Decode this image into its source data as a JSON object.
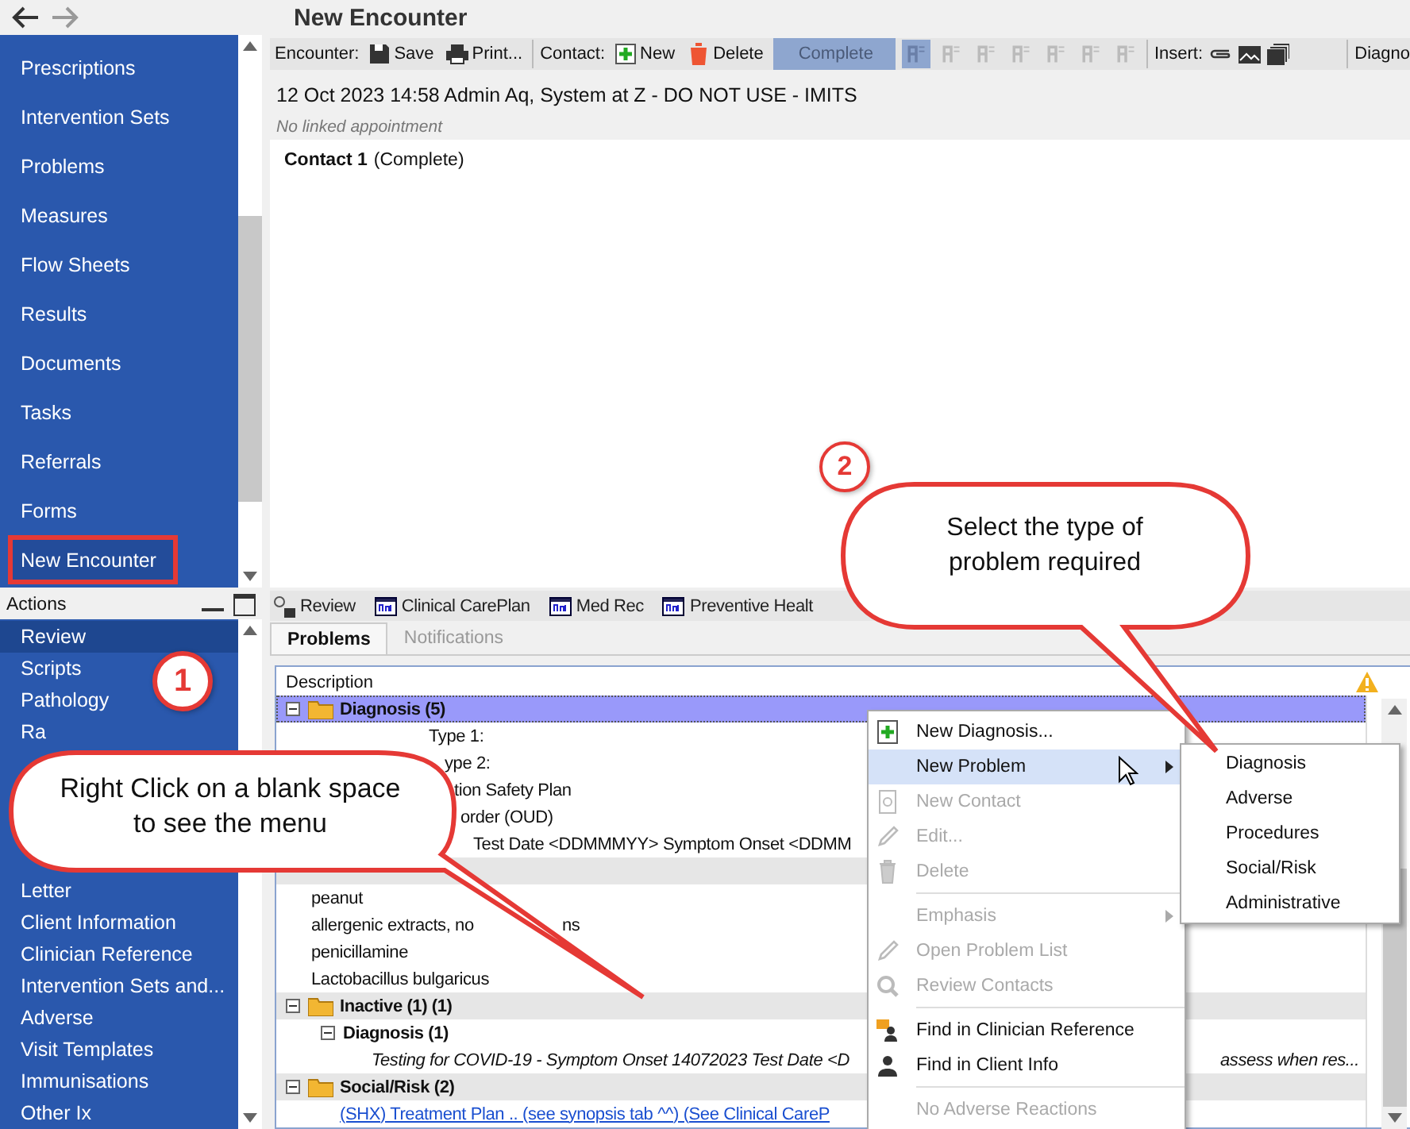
{
  "header": {
    "title": "New Encounter"
  },
  "nav": [
    {
      "label": "Prescriptions",
      "selected": false
    },
    {
      "label": "Intervention Sets",
      "selected": false
    },
    {
      "label": "Problems",
      "selected": false
    },
    {
      "label": "Measures",
      "selected": false
    },
    {
      "label": "Flow Sheets",
      "selected": false
    },
    {
      "label": "Results",
      "selected": false
    },
    {
      "label": "Documents",
      "selected": false
    },
    {
      "label": "Tasks",
      "selected": false
    },
    {
      "label": "Referrals",
      "selected": false
    },
    {
      "label": "Forms",
      "selected": false
    },
    {
      "label": "New Encounter",
      "selected": true
    }
  ],
  "toolbar": {
    "encounter_label": "Encounter:",
    "save": "Save",
    "print": "Print...",
    "contact_label": "Contact:",
    "new": "New",
    "delete": "Delete",
    "complete": "Complete",
    "insert_label": "Insert:",
    "cut_label": "Diagno"
  },
  "encounter": {
    "summary": "12 Oct 2023 14:58 Admin Aq, System at Z - DO NOT USE - IMITS",
    "appointment": "No linked appointment",
    "contact": "Contact 1",
    "contact_status": "(Complete)"
  },
  "actions": {
    "title": "Actions",
    "items_top": [
      {
        "label": "Review",
        "selected": true
      },
      {
        "label": "Scripts",
        "selected": false
      },
      {
        "label": "Pathology",
        "selected": false
      },
      {
        "label": "Ra",
        "selected": false
      }
    ],
    "items_bottom": [
      {
        "label": "Letter",
        "selected": false
      },
      {
        "label": "Client Information",
        "selected": false
      },
      {
        "label": "Clinician Reference",
        "selected": false
      },
      {
        "label": "Intervention Sets and...",
        "selected": false
      },
      {
        "label": "Adverse",
        "selected": false
      },
      {
        "label": "Visit Templates",
        "selected": false
      },
      {
        "label": "Immunisations",
        "selected": false
      },
      {
        "label": "Other Ix",
        "selected": false
      }
    ]
  },
  "tabs": [
    {
      "label": "Review",
      "selected": false
    },
    {
      "label": "Clinical CarePlan",
      "selected": false
    },
    {
      "label": "Med Rec",
      "selected": false
    },
    {
      "label": "Preventive Healt",
      "selected": false
    }
  ],
  "subtabs": [
    {
      "label": "Problems",
      "selected": true
    },
    {
      "label": "Notifications",
      "selected": false
    }
  ],
  "grid": {
    "column": "Description",
    "tree": [
      {
        "kind": "group",
        "label": "Diagnosis (5)",
        "selected": true,
        "children": [
          {
            "kind": "leaf",
            "label": "Type 1:"
          },
          {
            "kind": "leaf",
            "label": "ype 2:"
          },
          {
            "kind": "leaf",
            "label": "tion Safety Plan"
          },
          {
            "kind": "leaf",
            "label": "order (OUD)"
          },
          {
            "kind": "leaf",
            "label": "Test Date <DDMMMYY> Symptom Onset <DDMM"
          }
        ]
      },
      {
        "kind": "group",
        "selected": false,
        "children": [
          {
            "kind": "leaf",
            "label": "peanut"
          },
          {
            "kind": "leaf",
            "label": "allergenic extracts, no",
            "tail": "ns"
          },
          {
            "kind": "leaf",
            "label": "penicillamine"
          },
          {
            "kind": "leaf",
            "label": "Lactobacillus bulgaricus"
          }
        ]
      },
      {
        "kind": "group",
        "label": "Inactive (1) (1)",
        "selected": false,
        "children": [
          {
            "kind": "subgroup",
            "label": "Diagnosis (1)",
            "children": [
              {
                "kind": "note",
                "label": "Testing for COVID-19 - Symptom Onset 14072023 Test Date <D",
                "tail": "assess when res..."
              }
            ]
          }
        ]
      },
      {
        "kind": "group",
        "label": "Social/Risk (2)",
        "selected": false,
        "children": [
          {
            "kind": "link",
            "label": "(SHX) Treatment Plan .. (see synopsis tab ^^) (See Clinical CareP"
          }
        ]
      }
    ]
  },
  "menu": [
    {
      "kind": "item",
      "label": "New Diagnosis...",
      "disabled": false,
      "selected": false,
      "submenu": false
    },
    {
      "kind": "item",
      "label": "New Problem",
      "disabled": false,
      "selected": true,
      "submenu": true
    },
    {
      "kind": "item",
      "label": "New Contact",
      "disabled": true,
      "selected": false,
      "submenu": false
    },
    {
      "kind": "item",
      "label": "Edit...",
      "disabled": true,
      "selected": false,
      "submenu": false
    },
    {
      "kind": "item",
      "label": "Delete",
      "disabled": true,
      "selected": false,
      "submenu": false
    },
    {
      "kind": "separator"
    },
    {
      "kind": "item",
      "label": "Emphasis",
      "disabled": true,
      "selected": false,
      "submenu": true
    },
    {
      "kind": "item",
      "label": "Open Problem List",
      "disabled": true,
      "selected": false,
      "submenu": false
    },
    {
      "kind": "item",
      "label": "Review Contacts",
      "disabled": true,
      "selected": false,
      "submenu": false
    },
    {
      "kind": "separator"
    },
    {
      "kind": "item",
      "label": "Find in Clinician Reference",
      "disabled": false,
      "selected": false,
      "submenu": false
    },
    {
      "kind": "item",
      "label": "Find in Client Info",
      "disabled": false,
      "selected": false,
      "submenu": false
    },
    {
      "kind": "separator"
    },
    {
      "kind": "item",
      "label": "No Adverse Reactions",
      "disabled": true,
      "selected": false,
      "submenu": false
    }
  ],
  "submenu": [
    "Diagnosis",
    "Adverse",
    "Procedures",
    "Social/Risk",
    "Administrative"
  ],
  "callouts": [
    {
      "number": "1",
      "text": "Right Click on a blank space to see the menu"
    },
    {
      "number": "2",
      "text": "Select the type of problem required"
    }
  ]
}
